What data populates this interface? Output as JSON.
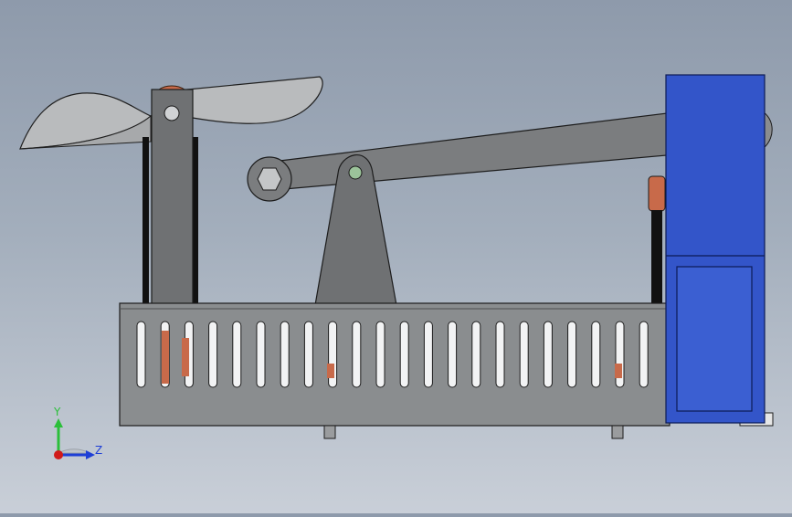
{
  "triad": {
    "y_label": "Y",
    "z_label": "Z",
    "colors": {
      "y_axis": "#2bbf3a",
      "z_axis": "#1f3fd6",
      "x_axis": "#d11a1a"
    }
  },
  "colors": {
    "background_top": "#8e9aab",
    "background_bottom": "#c9cfd8",
    "frame_grey": "#8a8d8f",
    "part_dark_grey": "#7a7c7e",
    "blade_light": "#b9bbbd",
    "motor_blue": "#3355c9",
    "copper": "#c86a4a"
  },
  "model": {
    "parts": [
      "fan-blade",
      "left-post",
      "lever-arm",
      "pivot-bracket",
      "slotted-base",
      "motor-housing",
      "belt",
      "feet"
    ],
    "slot_count": 22
  }
}
